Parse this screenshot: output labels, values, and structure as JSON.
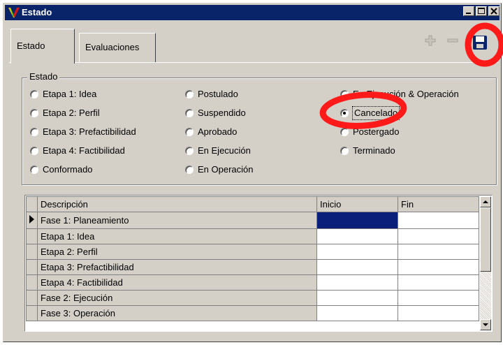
{
  "window": {
    "title": "Estado"
  },
  "tabs": [
    {
      "label": "Estado",
      "active": true
    },
    {
      "label": "Evaluaciones",
      "active": false
    }
  ],
  "toolbar": {
    "icons": [
      "add-icon",
      "remove-icon",
      "save-icon"
    ]
  },
  "group": {
    "legend": "Estado",
    "columns": [
      [
        {
          "label": "Etapa 1: Idea",
          "checked": false
        },
        {
          "label": "Etapa 2: Perfil",
          "checked": false
        },
        {
          "label": "Etapa 3: Prefactibilidad",
          "checked": false
        },
        {
          "label": "Etapa 4: Factibilidad",
          "checked": false
        },
        {
          "label": "Conformado",
          "checked": false
        }
      ],
      [
        {
          "label": "Postulado",
          "checked": false
        },
        {
          "label": "Suspendido",
          "checked": false
        },
        {
          "label": "Aprobado",
          "checked": false
        },
        {
          "label": "En Ejecución",
          "checked": false
        },
        {
          "label": "En Operación",
          "checked": false
        }
      ],
      [
        {
          "label": "En Ejecución & Operación",
          "checked": false
        },
        {
          "label": "Cancelado",
          "checked": true
        },
        {
          "label": "Postergado",
          "checked": false
        },
        {
          "label": "Terminado",
          "checked": false
        }
      ]
    ]
  },
  "grid": {
    "headers": [
      "Descripción",
      "Inicio",
      "Fin"
    ],
    "rows": [
      {
        "desc": "Fase 1: Planeamiento",
        "inicio": "",
        "fin": "",
        "current": true
      },
      {
        "desc": "Etapa 1: Idea",
        "inicio": "",
        "fin": ""
      },
      {
        "desc": "Etapa 2: Perfil",
        "inicio": "",
        "fin": ""
      },
      {
        "desc": "Etapa 3: Prefactibilidad",
        "inicio": "",
        "fin": ""
      },
      {
        "desc": "Etapa 4: Factibilidad",
        "inicio": "",
        "fin": ""
      },
      {
        "desc": "Fase 2: Ejecución",
        "inicio": "",
        "fin": ""
      },
      {
        "desc": "Fase 3: Operación",
        "inicio": "",
        "fin": ""
      }
    ]
  },
  "colors": {
    "titlebar": "#0a246a",
    "annotation": "#ff1a1a",
    "selection": "#0a1f7a"
  }
}
